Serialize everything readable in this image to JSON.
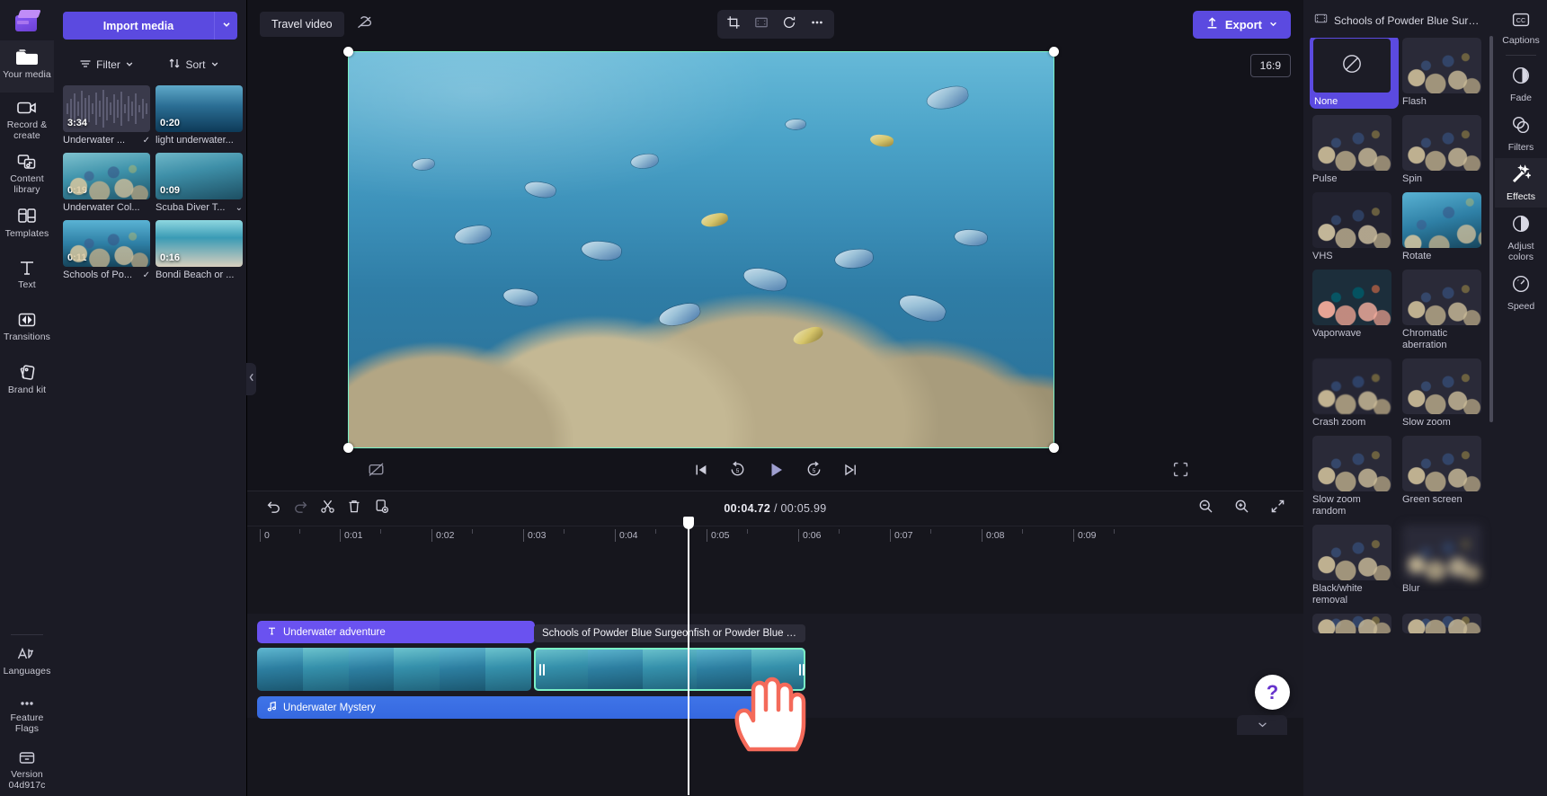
{
  "left_rail": {
    "logo": "clipchamp-logo",
    "items": [
      {
        "label": "Your media",
        "icon": "folder-icon",
        "active": true
      },
      {
        "label": "Record &\ncreate",
        "icon": "video-camera-icon",
        "active": false
      },
      {
        "label": "Content\nlibrary",
        "icon": "library-icon",
        "active": false
      },
      {
        "label": "Templates",
        "icon": "templates-icon",
        "active": false
      },
      {
        "label": "Text",
        "icon": "text-icon",
        "active": false
      },
      {
        "label": "Transitions",
        "icon": "transitions-icon",
        "active": false
      },
      {
        "label": "Brand kit",
        "icon": "brand-kit-icon",
        "active": false
      }
    ],
    "bottom_items": [
      {
        "label": "Languages",
        "icon": "languages-icon"
      },
      {
        "label": "Feature\nFlags",
        "icon": "ellipsis-icon"
      },
      {
        "label": "Version\n04d917c",
        "icon": "box-icon"
      }
    ]
  },
  "media_panel": {
    "import_label": "Import media",
    "import_caret": "chevron-down-icon",
    "filter_label": "Filter",
    "sort_label": "Sort",
    "items": [
      {
        "duration": "3:34",
        "name": "Underwater ...",
        "checked": true,
        "thumb": "audio-waveform"
      },
      {
        "duration": "0:20",
        "name": "light underwater...",
        "checked": false,
        "thumb": "th-a"
      },
      {
        "duration": "0:19",
        "name": "Underwater Col...",
        "checked": false,
        "thumb": "th-c"
      },
      {
        "duration": "0:09",
        "name": "Scuba Diver T...",
        "checked": true,
        "thumb": "th-b"
      },
      {
        "duration": "0:11",
        "name": "Schools of Po...",
        "checked": true,
        "thumb": "th-d"
      },
      {
        "duration": "0:16",
        "name": "Bondi Beach or ...",
        "checked": false,
        "thumb": "th-e"
      }
    ]
  },
  "top_bar": {
    "project_name": "Travel video",
    "cloud_icon": "cloud-off-icon",
    "tools": [
      {
        "name": "crop-icon"
      },
      {
        "name": "fit-icon"
      },
      {
        "name": "rotate-icon"
      },
      {
        "name": "more-options-icon"
      }
    ],
    "export_label": "Export",
    "export_icon": "upload-icon"
  },
  "stage": {
    "aspect_ratio": "16:9",
    "help_glyph": "?",
    "caption_toggle_icon": "captions-off-icon",
    "player": {
      "skip_start_icon": "skip-to-start-icon",
      "back5_icon": "rewind-5-icon",
      "play_icon": "play-icon",
      "fwd5_icon": "forward-5-icon",
      "skip_end_icon": "skip-to-end-icon",
      "fullscreen_icon": "fullscreen-icon"
    }
  },
  "timeline": {
    "tools": [
      {
        "name": "undo-icon"
      },
      {
        "name": "redo-icon"
      },
      {
        "name": "split-icon"
      },
      {
        "name": "delete-icon"
      },
      {
        "name": "duplicate-icon"
      }
    ],
    "current_time": "00:04.72",
    "total_time": " / 00:05.99",
    "zoom_out_icon": "zoom-out-icon",
    "zoom_in_icon": "zoom-in-icon",
    "fit_icon": "fit-timeline-icon",
    "ruler_ticks": [
      "0",
      "0:01",
      "0:02",
      "0:03",
      "0:04",
      "0:05",
      "0:06",
      "0:07",
      "0:08",
      "0:09"
    ],
    "playhead_time": "00:04.72",
    "clips": {
      "text_clip": {
        "label": "Underwater adventure",
        "icon": "text-icon"
      },
      "selected_clip_label": "Schools of Powder Blue Surgeonfish or Powder Blue Tan...",
      "audio_clip": {
        "label": "Underwater Mystery",
        "icon": "music-note-icon"
      }
    }
  },
  "effects_panel": {
    "header_title": "Schools of Powder Blue Surgeo...",
    "header_icon": "film-strip-icon",
    "effects": [
      {
        "name": "None",
        "thumb": "none",
        "selected": true
      },
      {
        "name": "Flash",
        "thumb": "reef-a",
        "selected": false
      },
      {
        "name": "Pulse",
        "thumb": "reef-b",
        "selected": false
      },
      {
        "name": "Spin",
        "thumb": "reef-c",
        "selected": false
      },
      {
        "name": "VHS",
        "thumb": "reef-vhs",
        "selected": false
      },
      {
        "name": "Rotate",
        "thumb": "reef-rot",
        "selected": false
      },
      {
        "name": "Vaporwave",
        "thumb": "reef-vapor",
        "selected": false
      },
      {
        "name": "Chromatic\naberration",
        "thumb": "reef-chrom",
        "selected": false
      },
      {
        "name": "Crash zoom",
        "thumb": "reef-crash",
        "selected": false
      },
      {
        "name": "Slow zoom",
        "thumb": "reef-slow",
        "selected": false
      },
      {
        "name": "Slow zoom\nrandom",
        "thumb": "reef-slowr",
        "selected": false
      },
      {
        "name": "Green screen",
        "thumb": "reef-green",
        "selected": false
      },
      {
        "name": "Black/white\nremoval",
        "thumb": "reef-bw",
        "selected": false
      },
      {
        "name": "Blur",
        "thumb": "reef-blur",
        "selected": false
      }
    ]
  },
  "right_rail": {
    "items": [
      {
        "label": "Captions",
        "icon": "captions-icon",
        "active": false
      },
      {
        "label": "Fade",
        "icon": "fade-icon",
        "active": false
      },
      {
        "label": "Filters",
        "icon": "filters-icon",
        "active": false
      },
      {
        "label": "Effects",
        "icon": "effects-icon",
        "active": true
      },
      {
        "label": "Adjust\ncolors",
        "icon": "adjust-colors-icon",
        "active": false
      },
      {
        "label": "Speed",
        "icon": "speed-icon",
        "active": false
      }
    ]
  },
  "colors": {
    "accent": "#5b4ae0",
    "text_clip": "#6a52f0",
    "audio_clip": "#3f74e8",
    "selection": "#7af0c6",
    "panel_bg": "#1b1b25",
    "app_bg": "#13131a"
  }
}
